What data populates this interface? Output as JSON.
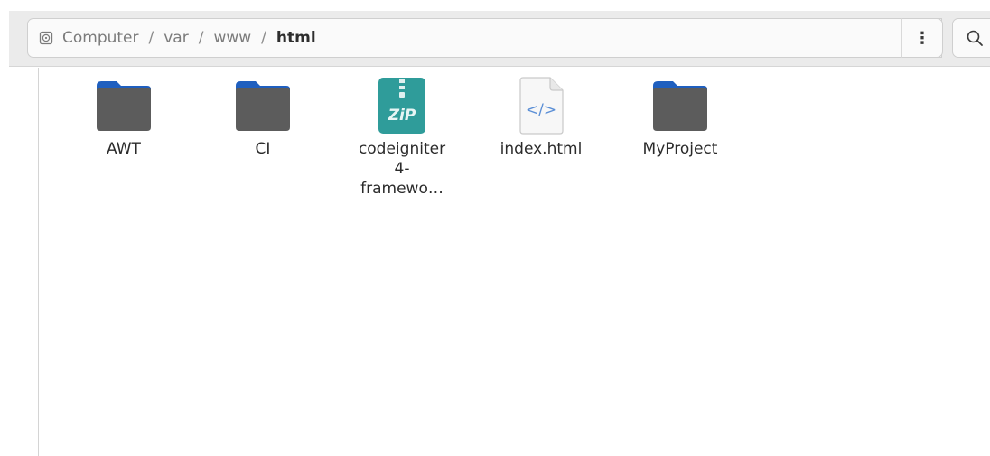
{
  "pathbar": {
    "root_icon": "disk-icon",
    "crumbs": [
      "Computer",
      "var",
      "www"
    ],
    "separator": "/",
    "current": "html"
  },
  "toolbar": {
    "menu_icon": "vertical-dots-icon",
    "menu_glyph": "⋮",
    "search_icon": "search-icon"
  },
  "files": [
    {
      "name": "AWT",
      "type": "folder",
      "icon": "folder-icon"
    },
    {
      "name": "CI",
      "type": "folder",
      "icon": "folder-icon"
    },
    {
      "name": "codeigniter\n4-\nframewo…",
      "type": "zip",
      "icon": "zip-icon",
      "icon_text": "ZiP"
    },
    {
      "name": "index.html",
      "type": "html",
      "icon": "html-file-icon",
      "icon_text": "</>"
    },
    {
      "name": "MyProject",
      "type": "folder",
      "icon": "folder-icon"
    }
  ],
  "colors": {
    "folder_tab": "#1f5fbf",
    "folder_body": "#5c5c5c",
    "zip": "#2f9c9a",
    "html_accent": "#5b8fd6"
  }
}
